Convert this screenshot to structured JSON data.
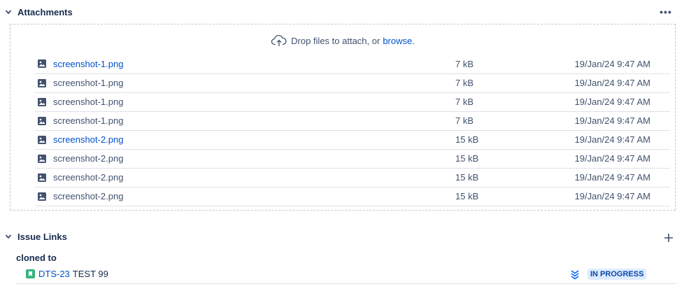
{
  "attachments": {
    "title": "Attachments",
    "more_label": "•••",
    "drop_text": "Drop files to attach, or",
    "browse_label": "browse.",
    "files": [
      {
        "name": "screenshot-1.png",
        "size": "7 kB",
        "date": "19/Jan/24 9:47 AM",
        "link": true
      },
      {
        "name": "screenshot-1.png",
        "size": "7 kB",
        "date": "19/Jan/24 9:47 AM",
        "link": false
      },
      {
        "name": "screenshot-1.png",
        "size": "7 kB",
        "date": "19/Jan/24 9:47 AM",
        "link": false
      },
      {
        "name": "screenshot-1.png",
        "size": "7 kB",
        "date": "19/Jan/24 9:47 AM",
        "link": false
      },
      {
        "name": "screenshot-2.png",
        "size": "15 kB",
        "date": "19/Jan/24 9:47 AM",
        "link": true
      },
      {
        "name": "screenshot-2.png",
        "size": "15 kB",
        "date": "19/Jan/24 9:47 AM",
        "link": false
      },
      {
        "name": "screenshot-2.png",
        "size": "15 kB",
        "date": "19/Jan/24 9:47 AM",
        "link": false
      },
      {
        "name": "screenshot-2.png",
        "size": "15 kB",
        "date": "19/Jan/24 9:47 AM",
        "link": false
      }
    ]
  },
  "issue_links": {
    "title": "Issue Links",
    "group_label": "cloned to",
    "items": [
      {
        "key": "DTS-23",
        "summary": "TEST 99",
        "status": "IN PROGRESS",
        "issue_icon": "story-bookmark-icon",
        "priority_icon": "priority-lowest-icon"
      }
    ]
  },
  "colors": {
    "link": "#0052cc",
    "text": "#172b4d",
    "muted": "#42526e",
    "story_green": "#36b37e",
    "status_bg": "#deebff",
    "status_text": "#0747a6",
    "priority_blue": "#0065ff"
  }
}
